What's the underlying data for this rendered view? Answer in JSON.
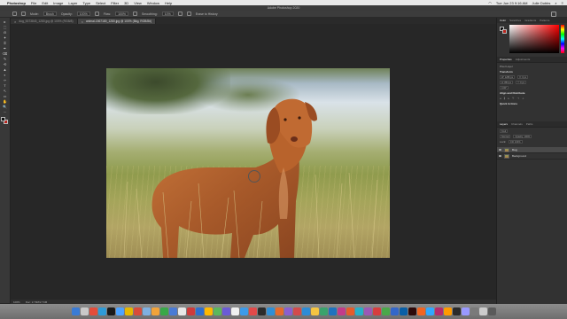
{
  "menubar": {
    "apple": "",
    "items": [
      "Photoshop",
      "File",
      "Edit",
      "Image",
      "Layer",
      "Type",
      "Select",
      "Filter",
      "3D",
      "View",
      "Window",
      "Help"
    ],
    "clock": "Tue Jun 23  9:16 AM",
    "user": "Julie Dobbs"
  },
  "window_title": "Adobe Photoshop 2020",
  "options": {
    "mode_label": "Mode:",
    "mode_value": "Brush",
    "opacity_label": "Opacity:",
    "opacity_value": "100%",
    "flow_label": "Flow:",
    "flow_value": "100%",
    "smoothing_label": "Smoothing:",
    "smoothing_value": "10%",
    "erase_label": "Erase to History"
  },
  "tabs": [
    {
      "label": "dog_5373843_1280.jpg @ 100% (RGB/8)",
      "active": false
    },
    {
      "label": "animal-1567180_1280.jpg @ 100% (Bkg, RGB/8#)",
      "active": true
    }
  ],
  "tools": [
    "▸",
    "⬚",
    "ʘ",
    "✦",
    "⌗",
    "✒",
    "⌫",
    "✎",
    "⟲",
    "▲",
    "◐",
    "✑",
    "T",
    "↖",
    "▭",
    "✋",
    "🔍",
    "⋯"
  ],
  "status": {
    "zoom": "100%",
    "doc": "Doc: 2.74M/2.74M"
  },
  "panels": {
    "color_tabs": [
      "Color",
      "Swatches",
      "Gradients",
      "Patterns"
    ],
    "properties_tabs": [
      "Properties",
      "Adjustments"
    ],
    "pixel_layer": "Pixel Layer",
    "transform": "Transform",
    "w": "W: 1280 px",
    "h": "H: 853 px",
    "x": "X: 0 px",
    "y": "Y: 0 px",
    "angle": "0.00°",
    "align": "Align and Distribute",
    "quick_actions": "Quick Actions",
    "layer_tabs": [
      "Layers",
      "Channels",
      "Paths"
    ],
    "kind": "Kind",
    "blend": "Normal",
    "opacity": "Opacity: 100%",
    "lock": "Lock:",
    "fill": "Fill: 100%",
    "layers": [
      {
        "name": "Dog",
        "selected": true
      },
      {
        "name": "Background",
        "selected": false
      }
    ]
  },
  "dock": {
    "colors": [
      "#3a7bd5",
      "#c9c9c9",
      "#e44d3a",
      "#2f9bd7",
      "#1a1a1a",
      "#4da3ff",
      "#e6b800",
      "#d94c3a",
      "#7fb0e0",
      "#f2a33a",
      "#39a848",
      "#4a7bd5",
      "#e8e8e8",
      "#cf3b3b",
      "#2e6fd0",
      "#ffb900",
      "#5cb85c",
      "#6b5bd6",
      "#f0f0f0",
      "#3d9be9",
      "#e24a4a",
      "#2b2b2b",
      "#2f8fd6",
      "#e66a2c",
      "#8a5fd0",
      "#d24b4b",
      "#2d8cd6",
      "#f5c542",
      "#3aa36c",
      "#1e73be",
      "#c23b8a",
      "#e55c2b",
      "#26b0c9",
      "#9b59b6",
      "#d63e3e",
      "#4aa84a",
      "#3467c9",
      "#0a5fa6",
      "#2d0a0a",
      "#f26522",
      "#31a8ff",
      "#b52d6e",
      "#ff9a00",
      "#2b2b2b",
      "#9999ff",
      "#7a7a7a",
      "#cccccc",
      "#5a5a5a"
    ]
  }
}
